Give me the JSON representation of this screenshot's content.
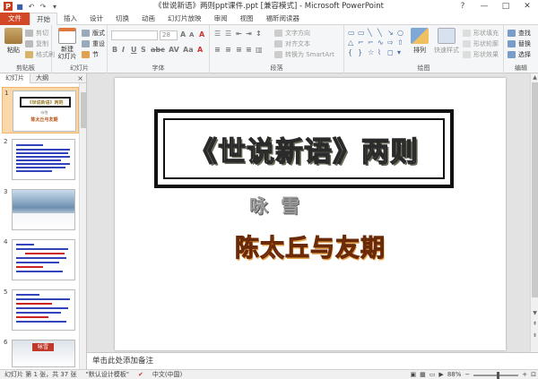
{
  "window": {
    "title": "《世说新语》两则ppt课件.ppt [兼容模式] - Microsoft PowerPoint",
    "controls": [
      "?",
      "—",
      "□",
      "✕"
    ]
  },
  "ribbon_tabs": [
    {
      "label": "文件"
    },
    {
      "label": "开始"
    },
    {
      "label": "插入"
    },
    {
      "label": "设计"
    },
    {
      "label": "切换"
    },
    {
      "label": "动画"
    },
    {
      "label": "幻灯片放映"
    },
    {
      "label": "审阅"
    },
    {
      "label": "视图"
    },
    {
      "label": "福昕阅读器"
    }
  ],
  "ribbon": {
    "clipboard": {
      "paste": "粘贴",
      "cut": "剪切",
      "copy": "复制",
      "format_painter": "格式刷",
      "label": "剪贴板"
    },
    "slides": {
      "new_slide": "新建\n幻灯片",
      "layout": "版式",
      "reset": "重设",
      "section": "节",
      "label": "幻灯片"
    },
    "font": {
      "font_size": "28",
      "label": "字体"
    },
    "paragraph": {
      "text_direction": "文字方向",
      "align_text": "对齐文本",
      "smartart": "转换为 SmartArt",
      "label": "段落"
    },
    "drawing": {
      "arrange": "排列",
      "quick_styles": "快速样式",
      "shape_fill": "形状填充",
      "shape_outline": "形状轮廓",
      "shape_effects": "形状效果",
      "label": "绘图"
    },
    "editing": {
      "find": "查找",
      "replace": "替换",
      "select": "选择",
      "label": "编辑"
    }
  },
  "left_panel": {
    "tabs": [
      "幻灯片",
      "大纲"
    ],
    "close": "×",
    "thumbnails": [
      {
        "num": "1",
        "title": "《世说新语》两则",
        "sub": "咏雪",
        "sub2": "陈太丘与友期"
      },
      {
        "num": "2"
      },
      {
        "num": "3"
      },
      {
        "num": "4"
      },
      {
        "num": "5"
      },
      {
        "num": "6",
        "label": "咏雪"
      }
    ]
  },
  "slide": {
    "title": "《世说新语》两则",
    "genre": "咏雪",
    "subtitle": "陈太丘与友期"
  },
  "notes": {
    "placeholder": "单击此处添加备注"
  },
  "status_bar": {
    "slide_info": "幻灯片 第 1 张，共 37 张",
    "theme": "\"默认设计模板\"",
    "language": "中文(中国)",
    "zoom": "88%",
    "zoom_fraction": 0.55
  }
}
